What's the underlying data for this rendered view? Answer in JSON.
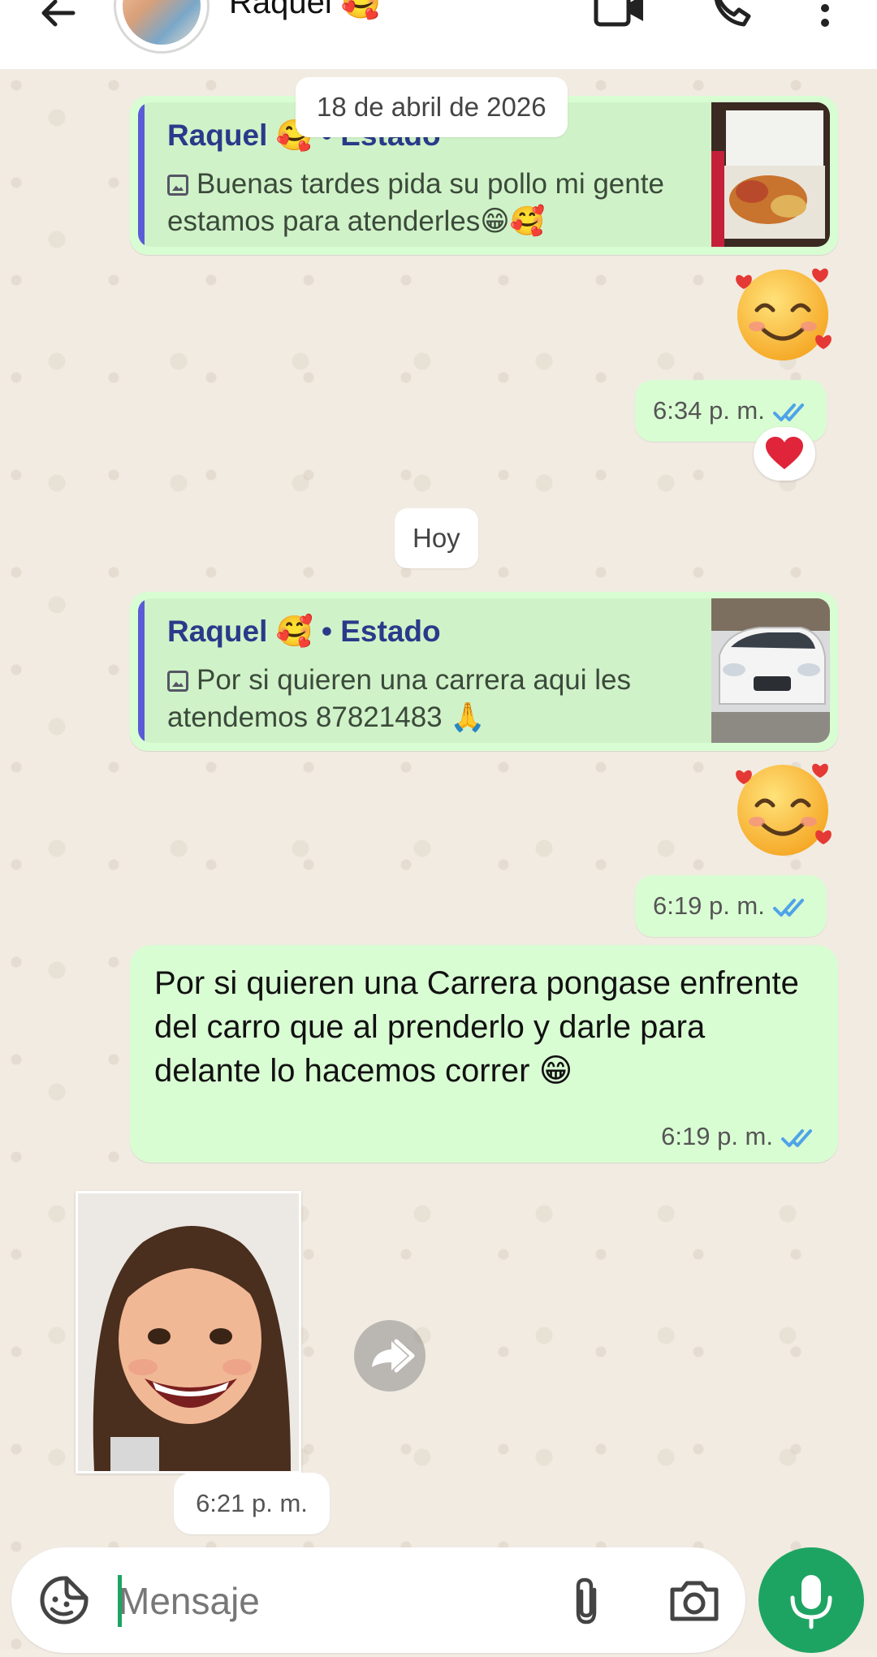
{
  "header": {
    "contact_name": "Raquel 🥰",
    "icons": [
      "back-arrow-icon",
      "video-call-icon",
      "phone-icon",
      "more-options-icon"
    ]
  },
  "date_separators": [
    "18 de abril de 2026",
    "Hoy"
  ],
  "messages": [
    {
      "reply": {
        "author": "Raquel 🥰",
        "separator": "•",
        "source": "Estado",
        "text": "Buenas tardes pida su pollo mi gente estamos para atenderles😁🥰"
      },
      "emoji": "🥰",
      "time": "6:34 p. m.",
      "reaction": "❤️"
    },
    {
      "reply": {
        "author": "Raquel 🥰",
        "separator": "•",
        "source": "Estado",
        "text": "Por si quieren una carrera aqui les atendemos 87821483 🙏"
      },
      "emoji": "🥰",
      "time": "6:19 p. m."
    },
    {
      "text": "Por si quieren una Carrera pongase enfrente del carro que al prenderlo y darle para delante lo hacemos correr 😁",
      "time": "6:19 p. m."
    },
    {
      "type": "image",
      "time": "6:21 p. m."
    }
  ],
  "composer": {
    "placeholder": "Mensaje"
  },
  "colors": {
    "outgoing_bubble": "#d9fdd3",
    "accent_green": "#1da463",
    "read_ticks": "#4fa3e8",
    "reply_bar": "#5b5bd6"
  }
}
